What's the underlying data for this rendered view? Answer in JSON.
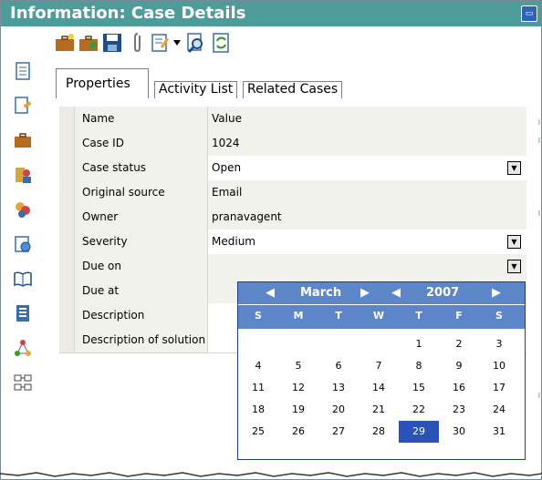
{
  "window": {
    "title": "Information: Case Details"
  },
  "toolbar": {
    "items": [
      "briefcase-new-icon",
      "briefcase-edit-icon",
      "save-icon",
      "paperclip-icon",
      "edit-note-icon",
      "find-icon",
      "refresh-icon"
    ]
  },
  "leftbar": {
    "items": [
      "notes-icon",
      "edit-document-icon",
      "briefcase-icon",
      "contacts-icon",
      "agents-icon",
      "schedule-icon",
      "knowledge-book-icon",
      "document-list-icon",
      "workflow-icon",
      "hierarchy-icon"
    ]
  },
  "tabs": [
    {
      "label": "Properties",
      "active": true
    },
    {
      "label": "Activity List",
      "active": false
    },
    {
      "label": "Related Cases",
      "active": false
    }
  ],
  "grid": {
    "header": {
      "name": "Name",
      "value": "Value"
    },
    "rows": [
      {
        "name": "Case ID",
        "value": "1024"
      },
      {
        "name": "Case status",
        "value": "Open"
      },
      {
        "name": "Original source",
        "value": "Email"
      },
      {
        "name": "Owner",
        "value": "pranavagent"
      },
      {
        "name": "Severity",
        "value": "Medium"
      },
      {
        "name": "Due on",
        "value": ""
      },
      {
        "name": "Due at",
        "value": ""
      },
      {
        "name": "Description",
        "value": ""
      },
      {
        "name": "Description of solution",
        "value": ""
      }
    ]
  },
  "calendar": {
    "month": "March",
    "year": "2007",
    "weekdays": [
      "S",
      "M",
      "T",
      "W",
      "T",
      "F",
      "S"
    ],
    "weeks": [
      [
        "",
        "",
        "",
        "",
        "1",
        "2",
        "3"
      ],
      [
        "4",
        "5",
        "6",
        "7",
        "8",
        "9",
        "10"
      ],
      [
        "11",
        "12",
        "13",
        "14",
        "15",
        "16",
        "17"
      ],
      [
        "18",
        "19",
        "20",
        "21",
        "22",
        "23",
        "24"
      ],
      [
        "25",
        "26",
        "27",
        "28",
        "29",
        "30",
        "31"
      ]
    ],
    "selected": "29"
  },
  "colors": {
    "title_bar": "#4e9c9a",
    "calendar_header": "#5c86c8",
    "selected_day": "#2a53b8"
  }
}
